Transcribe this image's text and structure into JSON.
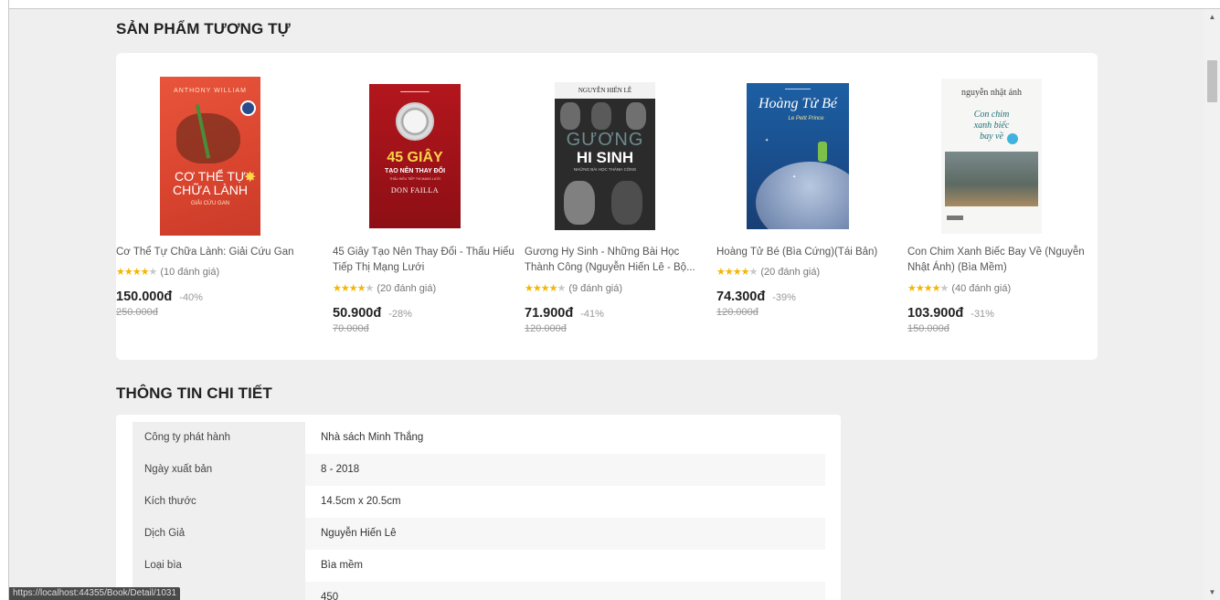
{
  "similar_section_title": "SẢN PHẨM TƯƠNG TỰ",
  "detail_section_title": "THÔNG TIN CHI TIẾT",
  "colors": {
    "star": "#f7b500",
    "background": "#efefef",
    "card": "#ffffff"
  },
  "products": [
    {
      "name": "Cơ Thể Tự Chữa Lành: Giải Cứu Gan",
      "stars": 4,
      "rating_text": "(10 đánh giá)",
      "price": "150.000đ",
      "discount": "-40%",
      "old_price": "250.000đ",
      "cover": {
        "author": "ANTHONY WILLIAM",
        "line1": "CƠ THỂ TỰ",
        "line2": "CHỮA LÀNH",
        "line3": "GIẢI CỨU GAN"
      }
    },
    {
      "name": "45 Giây Tạo Nên Thay Đổi - Thấu Hiểu Tiếp Thị Mạng Lưới",
      "stars": 4,
      "rating_text": "(20 đánh giá)",
      "price": "50.900đ",
      "discount": "-28%",
      "old_price": "70.000đ",
      "cover": {
        "line1": "45 GIÂY",
        "line2": "TẠO NÊN THAY ĐỔI",
        "line3": "THẤU HIỂU TIẾP THỊ MẠNG LƯỚI",
        "author": "DON FAILLA"
      }
    },
    {
      "name": "Gương Hy Sinh - Những Bài Học Thành Công (Nguyễn Hiến Lê - Bộ...",
      "stars": 4,
      "rating_text": "(9 đánh giá)",
      "price": "71.900đ",
      "discount": "-41%",
      "old_price": "120.000đ",
      "cover": {
        "author": "NGUYỄN HIẾN LÊ",
        "line1": "GƯƠNG",
        "line2": "HI SINH",
        "line3": "NHỮNG BÀI HỌC THÀNH CÔNG"
      }
    },
    {
      "name": "Hoàng Tử Bé (Bìa Cứng)(Tái Bản)",
      "stars": 4,
      "rating_text": "(20 đánh giá)",
      "price": "74.300đ",
      "discount": "-39%",
      "old_price": "120.000đ",
      "cover": {
        "line1": "Hoàng Tử Bé",
        "line2": "Le Petit Prince"
      }
    },
    {
      "name": "Con Chim Xanh Biếc Bay Về (Nguyễn Nhật Ánh) (Bìa Mềm)",
      "stars": 4,
      "rating_text": "(40 đánh giá)",
      "price": "103.900đ",
      "discount": "-31%",
      "old_price": "150.000đ",
      "cover": {
        "author": "nguyễn nhật ánh",
        "line1": "Con chim",
        "line2": "xanh biếc",
        "line3": "bay về"
      }
    }
  ],
  "details": [
    {
      "key": "Công ty phát hành",
      "value": "Nhà sách Minh Thắng"
    },
    {
      "key": "Ngày xuất bản",
      "value": "8 - 2018"
    },
    {
      "key": "Kích thước",
      "value": "14.5cm x 20.5cm"
    },
    {
      "key": "Dịch Giả",
      "value": "Nguyễn Hiến Lê"
    },
    {
      "key": "Loại bìa",
      "value": "Bìa mềm"
    },
    {
      "key": "",
      "value": "450"
    }
  ],
  "status_url": "https://localhost:44355/Book/Detail/1031"
}
